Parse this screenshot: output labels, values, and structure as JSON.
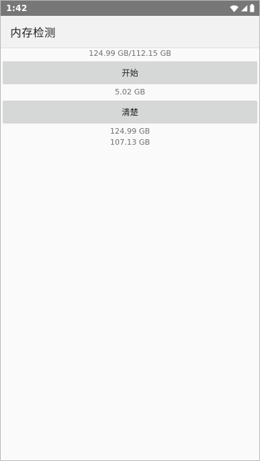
{
  "status_bar": {
    "time": "1:42",
    "icons": [
      "wifi-icon",
      "cellular-signal-icon",
      "battery-icon"
    ]
  },
  "app_bar": {
    "title": "内存检测"
  },
  "memory": {
    "total_display": "124.99 GB/112.15 GB",
    "start_button_label": "开始",
    "result_value": "5.02 GB",
    "clean_button_label": "清楚",
    "after_clean_total": "124.99 GB",
    "after_clean_available": "107.13 GB"
  },
  "colors": {
    "status_bar": "#777777",
    "app_bar": "#f2f2f2",
    "button": "#d6d7d7",
    "background": "#fafafa"
  }
}
